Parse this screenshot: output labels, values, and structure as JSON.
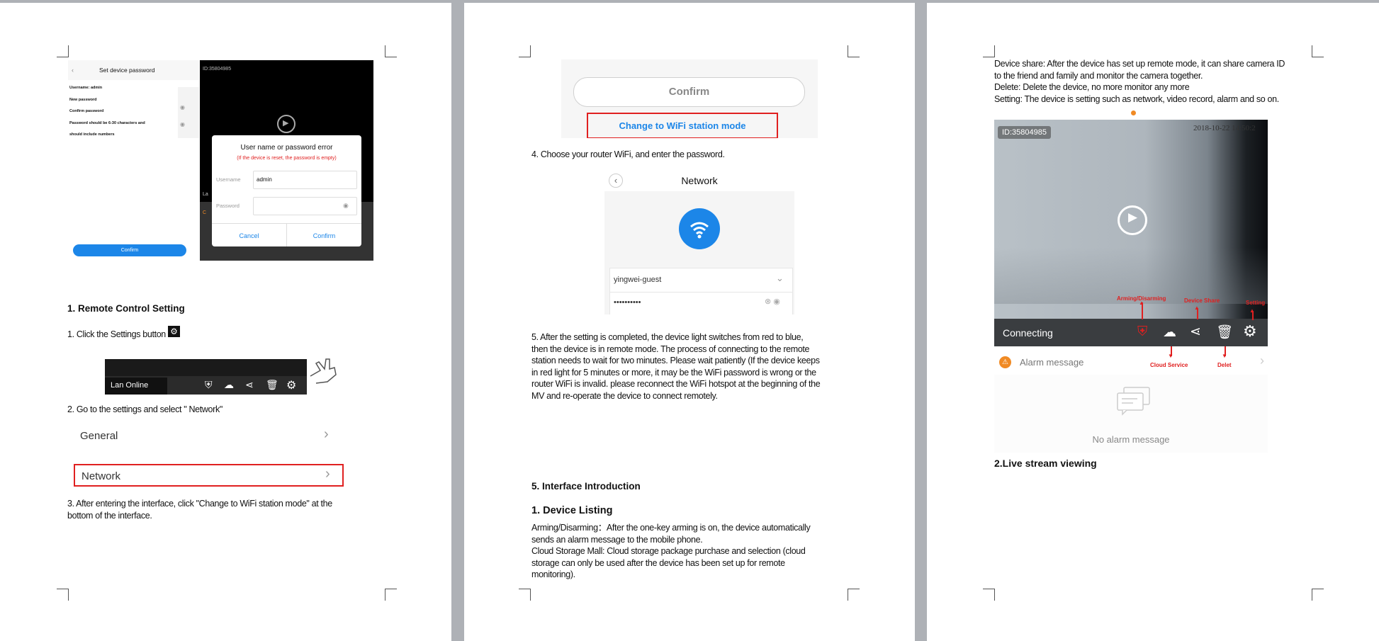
{
  "page1": {
    "set_password": {
      "title": "Set device password",
      "rows": [
        "Username: admin",
        "New password",
        "Confirm password",
        "Password should be 6-30 characters and",
        "should include numbers"
      ],
      "confirm": "Confirm"
    },
    "dialog": {
      "device_id": "ID:35804985",
      "title": "User name or password error",
      "hint": "(If the device is reset, the password is empty)",
      "username_label": "Username",
      "username_value": "admin",
      "password_label": "Password",
      "cancel": "Cancel",
      "confirm": "Confirm",
      "bg_left_1": "La",
      "bg_left_2": "C"
    },
    "section_heading": "1. Remote Control Setting",
    "step1_text": "1. Click the Settings button",
    "toolbar_status": "Lan Online",
    "step2_text": "2. Go to the settings    and select \" Network\"",
    "menu_general": "General",
    "menu_network": "Network",
    "step3_lines": [
      "3.    After entering the interface, click \"Change to WiFi station mode\" at the",
      "bottom of the interface."
    ]
  },
  "page2": {
    "confirm_button": "Confirm",
    "change_mode_link": "Change to WiFi station mode",
    "step4_text": "4.    Choose your router WiFi, and enter the password.",
    "network": {
      "title": "Network",
      "ssid": "yingwei-guest",
      "password_mask": "••••••••••"
    },
    "step5_lines": [
      "5. After the setting is completed, the device light switches from red to blue,",
      "then the device is in remote mode. The process of connecting to the remote",
      "station needs to wait for two minutes. Please wait patiently (If the device keeps",
      "in red light for 5 minutes or more, it may be the WiFi password is wrong or the",
      "router WiFi is invalid. please reconnect the WiFi hotspot at the beginning of the",
      "MV and re-operate the device to connect remotely."
    ],
    "interface_heading": "5. Interface Introduction",
    "device_listing_heading": "1. Device Listing",
    "listing_lines": [
      "Arming/Disarming：After the one-key arming is on, the device automatically",
      "sends an alarm message to the mobile phone.",
      "Cloud Storage Mall: Cloud storage package purchase and selection (cloud",
      "storage can only be used after the device has been set up for remote",
      "monitoring)."
    ]
  },
  "page3": {
    "intro_lines": [
      "Device share: After the device has set up remote mode, it can share camera ID",
      "to the friend and family and monitor the camera together.",
      "Delete: Delete the device, no more monitor any more",
      "Setting:  The device is setting such as network, video record, alarm and so on."
    ],
    "camera": {
      "device_id": "ID:35804985",
      "timestamp": "2018-10-22  14:50:2",
      "status": "Connecting",
      "label_arming": "Arming/Disarming",
      "label_share": "Device Share",
      "label_setting": "Setting",
      "label_cloud": "Cloud Service",
      "label_delete": "Delet"
    },
    "alarm_message": "Alarm message",
    "no_alarm": "No alarm message",
    "live_heading": "2.Live stream viewing"
  },
  "colors": {
    "accent_blue": "#1c86e8",
    "alert_red": "#e02020",
    "alarm_orange": "#f08a24",
    "viewer_black": "#000000"
  }
}
